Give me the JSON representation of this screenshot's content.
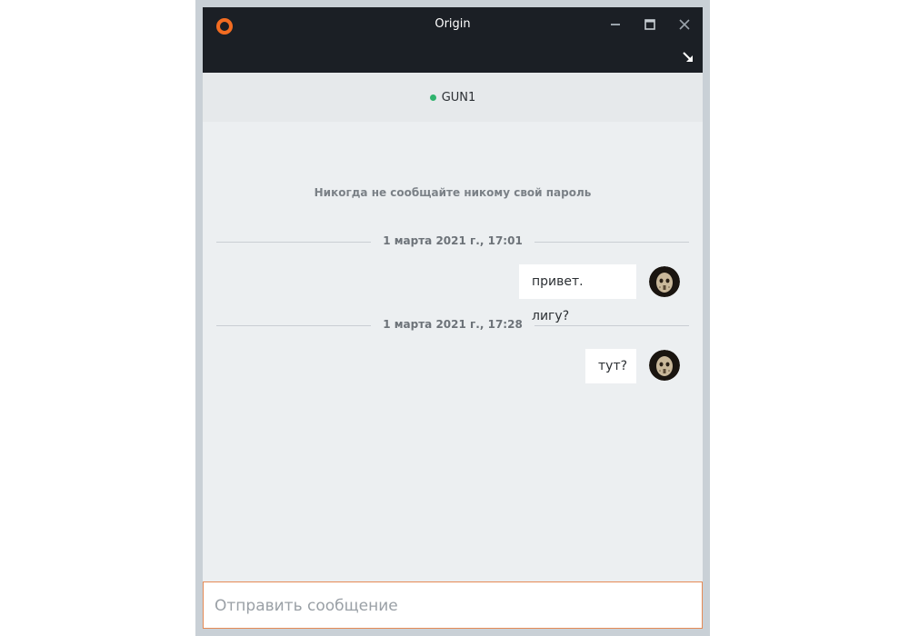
{
  "window": {
    "title": "Origin",
    "icons": {
      "logo": "origin-logo-icon",
      "minimize": "minimize-icon",
      "maximize": "maximize-icon",
      "close": "close-icon",
      "popout": "popout-arrow-icon"
    }
  },
  "header": {
    "contact_name": "GUN1",
    "presence_color": "#2fb36d"
  },
  "chat": {
    "warning": "Никогда не сообщайте никому свой пароль",
    "groups": [
      {
        "timestamp": "1 марта 2021 г., 17:01",
        "message": "привет. лигу?"
      },
      {
        "timestamp": "1 марта 2021 г., 17:28",
        "message": "тут?"
      }
    ]
  },
  "composer": {
    "placeholder": "Отправить сообщение",
    "accent": "#e58a55"
  },
  "colors": {
    "titlebar": "#1b1f25",
    "logo": "#f36c21"
  }
}
